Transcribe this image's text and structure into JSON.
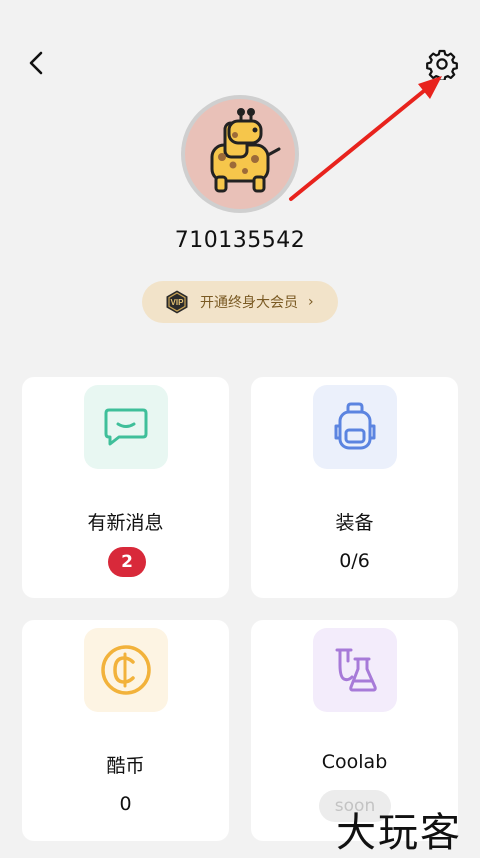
{
  "header": {
    "back_icon": "chevron-left-icon",
    "settings_icon": "gear-icon"
  },
  "profile": {
    "username": "710135542",
    "avatar_icon": "giraffe-avatar-icon"
  },
  "vip": {
    "badge_text": "VIP",
    "label": "开通终身大会员",
    "chevron": "›"
  },
  "cards": {
    "messages": {
      "title": "有新消息",
      "count": "2",
      "icon": "chat-icon",
      "accent": "#3fbf9a"
    },
    "equipment": {
      "title": "装备",
      "value": "0/6",
      "icon": "backpack-icon",
      "accent": "#5b84e0"
    },
    "coins": {
      "title": "酷币",
      "value": "0",
      "icon": "coin-icon",
      "accent": "#f2b23b"
    },
    "coolab": {
      "title": "Coolab",
      "status": "soon",
      "icon": "flask-icon",
      "accent": "#a77ad8"
    }
  },
  "watermark": "大玩客"
}
